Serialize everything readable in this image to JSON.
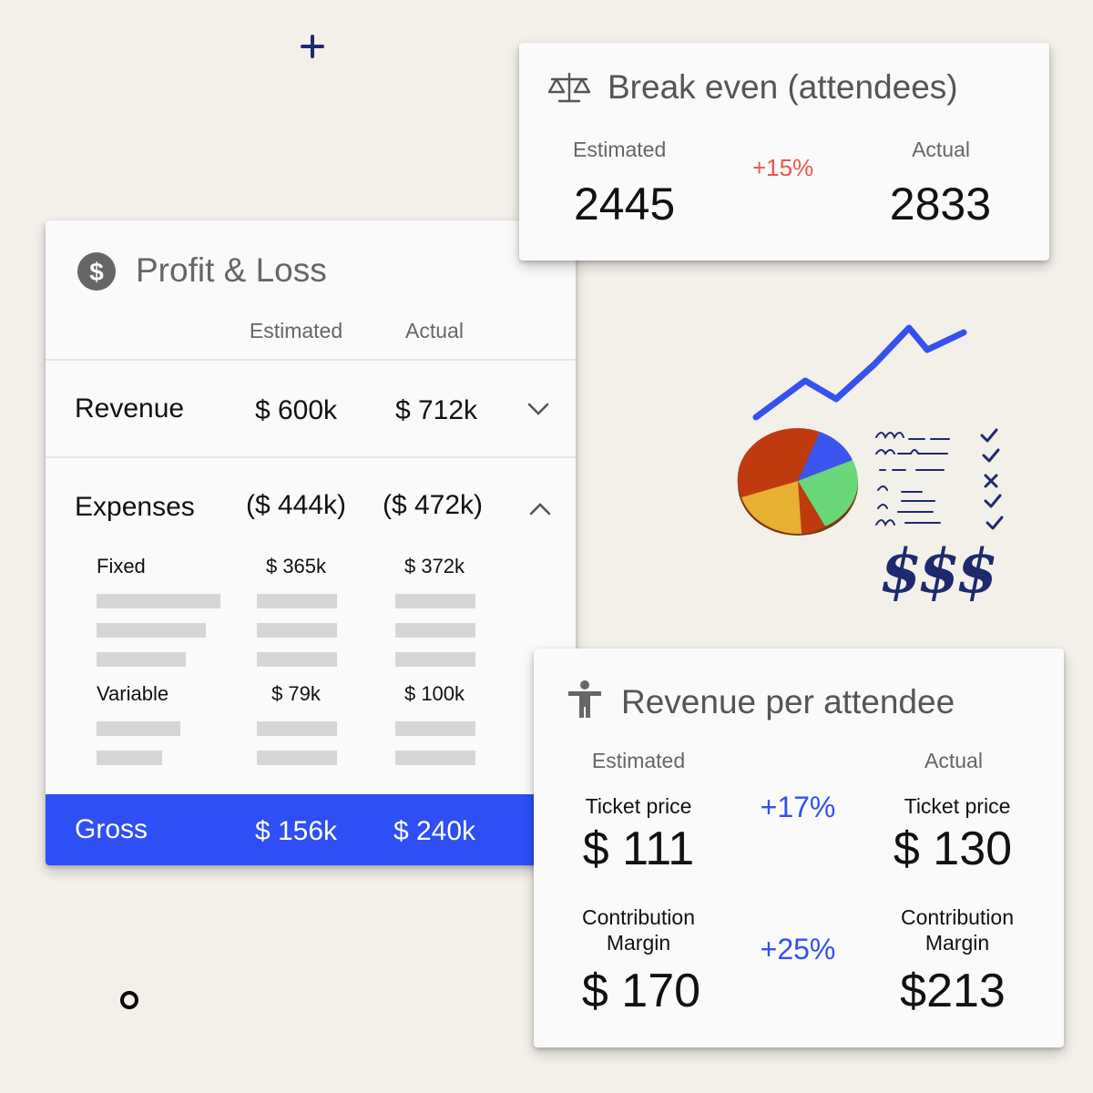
{
  "break_even": {
    "title": "Break even (attendees)",
    "icon": "scale-icon",
    "estimated_label": "Estimated",
    "actual_label": "Actual",
    "estimated_value": "2445",
    "actual_value": "2833",
    "change": "+15%",
    "change_color": "#f05545"
  },
  "profit_loss": {
    "title": "Profit & Loss",
    "icon": "dollar-circle-icon",
    "col_estimated": "Estimated",
    "col_actual": "Actual",
    "revenue": {
      "label": "Revenue",
      "estimated": "$ 600k",
      "actual": "$ 712k"
    },
    "expenses": {
      "label": "Expenses",
      "estimated": "($ 444k)",
      "actual": "($ 472k)"
    },
    "fixed": {
      "label": "Fixed",
      "estimated": "$ 365k",
      "actual": "$ 372k"
    },
    "variable": {
      "label": "Variable",
      "estimated": "$ 79k",
      "actual": "$ 100k"
    },
    "gross": {
      "label": "Gross",
      "estimated": "$ 156k",
      "actual": "$ 240k"
    },
    "gross_color": "#2e4ff5"
  },
  "revenue_per_attendee": {
    "title": "Revenue per attendee",
    "icon": "person-icon",
    "estimated_label": "Estimated",
    "actual_label": "Actual",
    "ticket_label": "Ticket price",
    "ticket_estimated": "$ 111",
    "ticket_actual": "$ 130",
    "ticket_change": "+17%",
    "cm_label_line1": "Contribution",
    "cm_label_line2": "Margin",
    "cm_estimated": "$ 170",
    "cm_actual": "$213",
    "cm_change": "+25%",
    "change_color": "#3350f0"
  },
  "illustration": {
    "dollar_signs": "$$$",
    "checklist_marks": [
      "✓",
      "✓",
      "✕",
      "✓",
      "✓"
    ]
  }
}
